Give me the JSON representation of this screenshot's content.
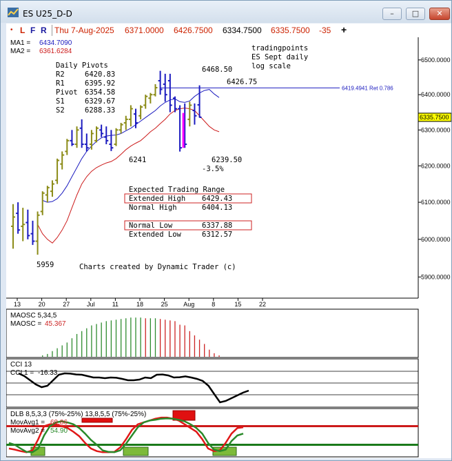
{
  "window": {
    "title": "ES U25_D-D",
    "minimize_label": "–",
    "maximize_label": "□",
    "close_label": "✕",
    "icon": "chart-app-icon"
  },
  "toolbar": {
    "item_dot": "•",
    "item_L": "L",
    "item_F": "F",
    "item_R": "R",
    "date": "Thu 7-Aug-2025",
    "open": "6371.0000",
    "high": "6426.7500",
    "low": "6334.7500",
    "close": "6335.7500",
    "change": "-35",
    "plus": "+"
  },
  "colors": {
    "up_bar": "#8b8b17",
    "down_bar": "#1b1bbf",
    "ma1": "#1b1bbf",
    "ma2": "#cc1a1a",
    "osc_up": "#2e8b2e",
    "osc_down": "#cc2222",
    "magenta": "#ff00ff"
  },
  "chart_data": [
    {
      "type": "ohlc",
      "scale": "log",
      "ylim": [
        5850,
        6560
      ],
      "yticks": [
        {
          "v": 6500,
          "label": "6500.0000"
        },
        {
          "v": 6400,
          "label": "6400.0000"
        },
        {
          "v": 6300,
          "label": "6300.0000"
        },
        {
          "v": 6200,
          "label": "6200.0000"
        },
        {
          "v": 6100,
          "label": "6100.0000"
        },
        {
          "v": 6000,
          "label": "6000.0000"
        },
        {
          "v": 5900,
          "label": "5900.0000"
        }
      ],
      "xticks": [
        {
          "i": 0,
          "label": "13"
        },
        {
          "i": 5,
          "label": "20"
        },
        {
          "i": 10,
          "label": "27"
        },
        {
          "i": 15,
          "label": "Jul"
        },
        {
          "i": 20,
          "label": "11"
        },
        {
          "i": 25,
          "label": "18"
        },
        {
          "i": 30,
          "label": "25"
        },
        {
          "i": 35,
          "label": "Aug"
        },
        {
          "i": 40,
          "label": "8"
        },
        {
          "i": 45,
          "label": "15"
        },
        {
          "i": 50,
          "label": "22"
        }
      ],
      "bars": [
        [
          6035,
          6095,
          5975,
          6060
        ],
        [
          6070,
          6100,
          6015,
          6025
        ],
        [
          6035,
          6085,
          5995,
          6040
        ],
        [
          6045,
          6080,
          6000,
          6010
        ],
        [
          6015,
          6050,
          5985,
          5995
        ],
        [
          5995,
          6075,
          5959,
          6065
        ],
        [
          6075,
          6130,
          6065,
          6125
        ],
        [
          6120,
          6145,
          6100,
          6140
        ],
        [
          6130,
          6160,
          6115,
          6150
        ],
        [
          6160,
          6220,
          6150,
          6215
        ],
        [
          6205,
          6240,
          6190,
          6230
        ],
        [
          6240,
          6275,
          6230,
          6270
        ],
        [
          6270,
          6300,
          6255,
          6260
        ],
        [
          6260,
          6310,
          6250,
          6300
        ],
        [
          6305,
          6330,
          6250,
          6260
        ],
        [
          6260,
          6290,
          6240,
          6250
        ],
        [
          6260,
          6300,
          6245,
          6290
        ],
        [
          6270,
          6310,
          6265,
          6305
        ],
        [
          6300,
          6315,
          6280,
          6290
        ],
        [
          6280,
          6310,
          6260,
          6270
        ],
        [
          6260,
          6300,
          6241,
          6250
        ],
        [
          6260,
          6305,
          6255,
          6300
        ],
        [
          6300,
          6320,
          6290,
          6315
        ],
        [
          6320,
          6340,
          6300,
          6330
        ],
        [
          6330,
          6370,
          6310,
          6360
        ],
        [
          6345,
          6360,
          6305,
          6320
        ],
        [
          6340,
          6370,
          6330,
          6365
        ],
        [
          6370,
          6400,
          6360,
          6395
        ],
        [
          6390,
          6405,
          6375,
          6400
        ],
        [
          6400,
          6430,
          6395,
          6420
        ],
        [
          6440,
          6468.5,
          6400,
          6415
        ],
        [
          6430,
          6460,
          6380,
          6400
        ],
        [
          6440,
          6460,
          6350,
          6370
        ],
        [
          6390,
          6395,
          6350,
          6360
        ],
        [
          6360,
          6370,
          6239.5,
          6250
        ],
        [
          6300,
          6375,
          6250,
          6260
        ],
        [
          6330,
          6380,
          6310,
          6370
        ],
        [
          6355,
          6375,
          6315,
          6340
        ],
        [
          6371,
          6426.75,
          6334.75,
          6335.75
        ]
      ],
      "ma1": {
        "name": "MA1",
        "value": "6434.7090",
        "label": "MA1 =",
        "values": [
          null,
          null,
          null,
          null,
          null,
          null,
          6105,
          6100,
          6102,
          6110,
          6125,
          6145,
          6170,
          6195,
          6220,
          6240,
          6255,
          6268,
          6278,
          6283,
          6285,
          6286,
          6290,
          6298,
          6305,
          6315,
          6325,
          6335,
          6345,
          6355,
          6368,
          6378,
          6385,
          6388,
          6380,
          6378,
          6382,
          6395,
          6405,
          6412,
          6415,
          6402,
          6392
        ]
      },
      "ma2": {
        "name": "MA2",
        "value": "6361.6284",
        "label": "MA2 =",
        "values": [
          null,
          null,
          null,
          null,
          null,
          6040,
          6015,
          6000,
          5990,
          6005,
          6025,
          6050,
          6085,
          6120,
          6150,
          6170,
          6185,
          6195,
          6202,
          6208,
          6212,
          6220,
          6232,
          6245,
          6255,
          6263,
          6270,
          6282,
          6295,
          6305,
          6318,
          6330,
          6345,
          6355,
          6360,
          6362,
          6360,
          6355,
          6340,
          6325,
          6310,
          6300,
          6295
        ]
      },
      "pivots": {
        "heading": "Daily Pivots",
        "rows": [
          {
            "label": "R2",
            "value": "6420.83"
          },
          {
            "label": "R1",
            "value": "6395.92"
          },
          {
            "label": "Pivot",
            "value": "6354.58"
          },
          {
            "label": "S1",
            "value": "6329.67"
          },
          {
            "label": "S2",
            "value": "6288.33"
          }
        ]
      },
      "note": {
        "line1": "tradingpoints",
        "line2": "ES Sept daily",
        "line3": "log scale"
      },
      "range": {
        "heading": "Expected Trading Range",
        "rows": [
          {
            "label": "Extended High",
            "value": "6429.43",
            "boxed": true
          },
          {
            "label": "Normal High",
            "value": "6404.13",
            "boxed": false
          },
          {
            "label": "Normal Low",
            "value": "6337.88",
            "boxed": true
          },
          {
            "label": "Extended Low",
            "value": "6312.57",
            "boxed": false
          }
        ]
      },
      "annotations": {
        "hi1": "6468.50",
        "hi2": "6426.75",
        "low1": "6241",
        "low2": "6239.50",
        "pct": "-3.5%",
        "low0": "5959",
        "ret_label": "6419.4941 Ret 0.786",
        "ret_value": 6419.4941,
        "last_price": "6335.7500",
        "credit": "Charts created by Dynamic Trader (c)"
      }
    },
    {
      "type": "bar",
      "name": "MAOSC",
      "label1": "MAOSC 5,34,5",
      "label2": "MAOSC = ",
      "label2_value": "45.367",
      "values": [
        0,
        0,
        0,
        0,
        0,
        0,
        2,
        4,
        8,
        12,
        16,
        20,
        26,
        32,
        36,
        40,
        44,
        46,
        48,
        50,
        51,
        52,
        53,
        54,
        55,
        55,
        55,
        54,
        54,
        54,
        53,
        52,
        51,
        50,
        45,
        44,
        36,
        30,
        24,
        18,
        10,
        5,
        2
      ]
    },
    {
      "type": "line",
      "name": "CCI",
      "label1": "CCI 13",
      "label2": "CCI 1 = ",
      "label2_value": "-16.33",
      "values": [
        70,
        50,
        20,
        -10,
        -30,
        -20,
        20,
        60,
        70,
        68,
        62,
        60,
        50,
        40,
        40,
        35,
        40,
        38,
        30,
        20,
        20,
        25,
        40,
        35,
        60,
        62,
        55,
        40,
        42,
        48,
        40,
        30,
        15,
        -20,
        -80,
        -140,
        -130,
        -110,
        -90,
        -70,
        -55
      ]
    },
    {
      "type": "line",
      "name": "DLB",
      "label1": "DLB 8,5,3,3 (75%-25%) 13,8,5,5 (75%-25%)",
      "mov1_label": "MovAvg1 = ",
      "mov1_value": "69.86",
      "mov2_label": "MovAvg2 = ",
      "mov2_value": "54.90",
      "mov1": [
        15,
        12,
        8,
        5,
        10,
        40,
        75,
        80,
        80,
        75,
        70,
        60,
        48,
        30,
        15,
        8,
        5,
        5,
        6,
        18,
        40,
        65,
        80,
        85,
        90,
        95,
        98,
        98,
        95,
        90,
        80,
        70,
        60,
        40,
        15,
        8,
        10,
        30,
        55,
        70,
        72
      ],
      "mov2": [
        30,
        25,
        15,
        6,
        5,
        15,
        50,
        75,
        85,
        88,
        85,
        80,
        70,
        55,
        38,
        25,
        10,
        6,
        5,
        10,
        28,
        50,
        72,
        85,
        90,
        92,
        95,
        96,
        95,
        92,
        88,
        80,
        70,
        55,
        30,
        12,
        8,
        12,
        35,
        50,
        55
      ]
    }
  ]
}
